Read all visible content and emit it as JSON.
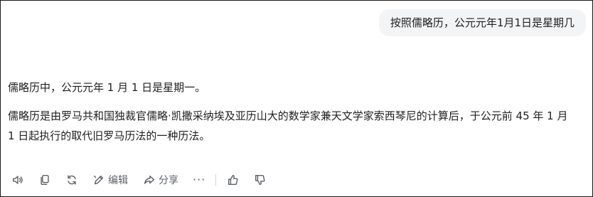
{
  "conversation": {
    "user_message": "按照儒略历，公元元年1月1日是星期几",
    "assistant_paragraphs": [
      "儒略历中，公元元年 1 月 1 日是星期一。",
      "儒略历是由罗马共和国独裁官儒略·凯撒采纳埃及亚历山大的数学家兼天文学家索西琴尼的计算后，于公元前 45 年 1 月 1 日起执行的取代旧罗马历法的一种历法。"
    ]
  },
  "toolbar": {
    "edit_label": "编辑",
    "share_label": "分享",
    "more_label": "···",
    "icons": {
      "read_aloud": "speaker-icon",
      "copy": "copy-icon",
      "regenerate": "refresh-icon",
      "edit": "edit-icon",
      "share": "share-icon",
      "more": "more-icon",
      "like": "thumbs-up-icon",
      "dislike": "thumbs-down-icon"
    }
  },
  "colors": {
    "user_bubble_bg": "#f3f4f6",
    "text": "#1f1f1f",
    "icon": "#5f6368"
  }
}
